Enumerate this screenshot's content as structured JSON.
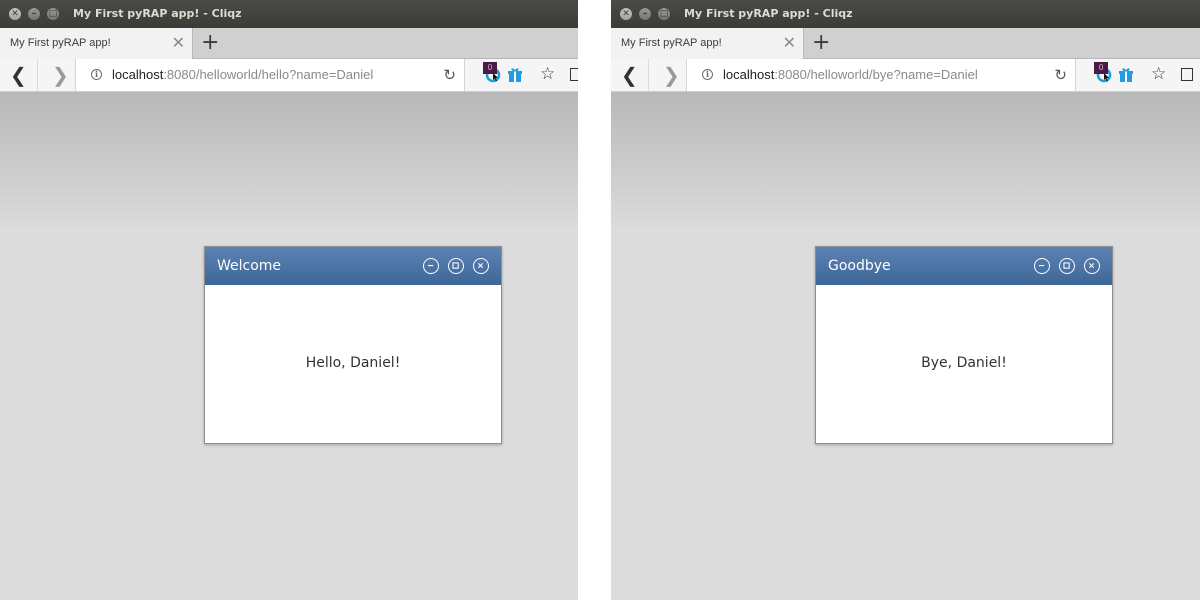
{
  "left": {
    "window_title": "My First pyRAP app! - Cliqz",
    "tab_label": "My First pyRAP app!",
    "url": {
      "host": "localhost",
      "rest": ":8080/helloworld/hello?name=Daniel"
    },
    "dialog": {
      "title": "Welcome",
      "message": "Hello, Daniel!"
    }
  },
  "right": {
    "window_title": "My First pyRAP app! - Cliqz",
    "tab_label": "My First pyRAP app!",
    "url": {
      "host": "localhost",
      "rest": ":8080/helloworld/bye?name=Daniel"
    },
    "dialog": {
      "title": "Goodbye",
      "message": "Bye, Daniel!"
    }
  },
  "extension_badge": "0",
  "icons": {
    "window_controls": [
      "close-icon",
      "minimize-icon",
      "maximize-icon"
    ],
    "nav": [
      "back-arrow-icon",
      "forward-arrow-icon",
      "info-icon",
      "reload-icon"
    ],
    "toolbar": [
      "cliqz-icon",
      "gift-icon",
      "star-icon",
      "library-icon"
    ],
    "dialog": [
      "minimize-icon",
      "maximize-icon",
      "close-icon"
    ]
  },
  "colors": {
    "dialog_header": "#4a72a4",
    "titlebar": "#3c3b37",
    "page_background": "#dcdcdc"
  }
}
